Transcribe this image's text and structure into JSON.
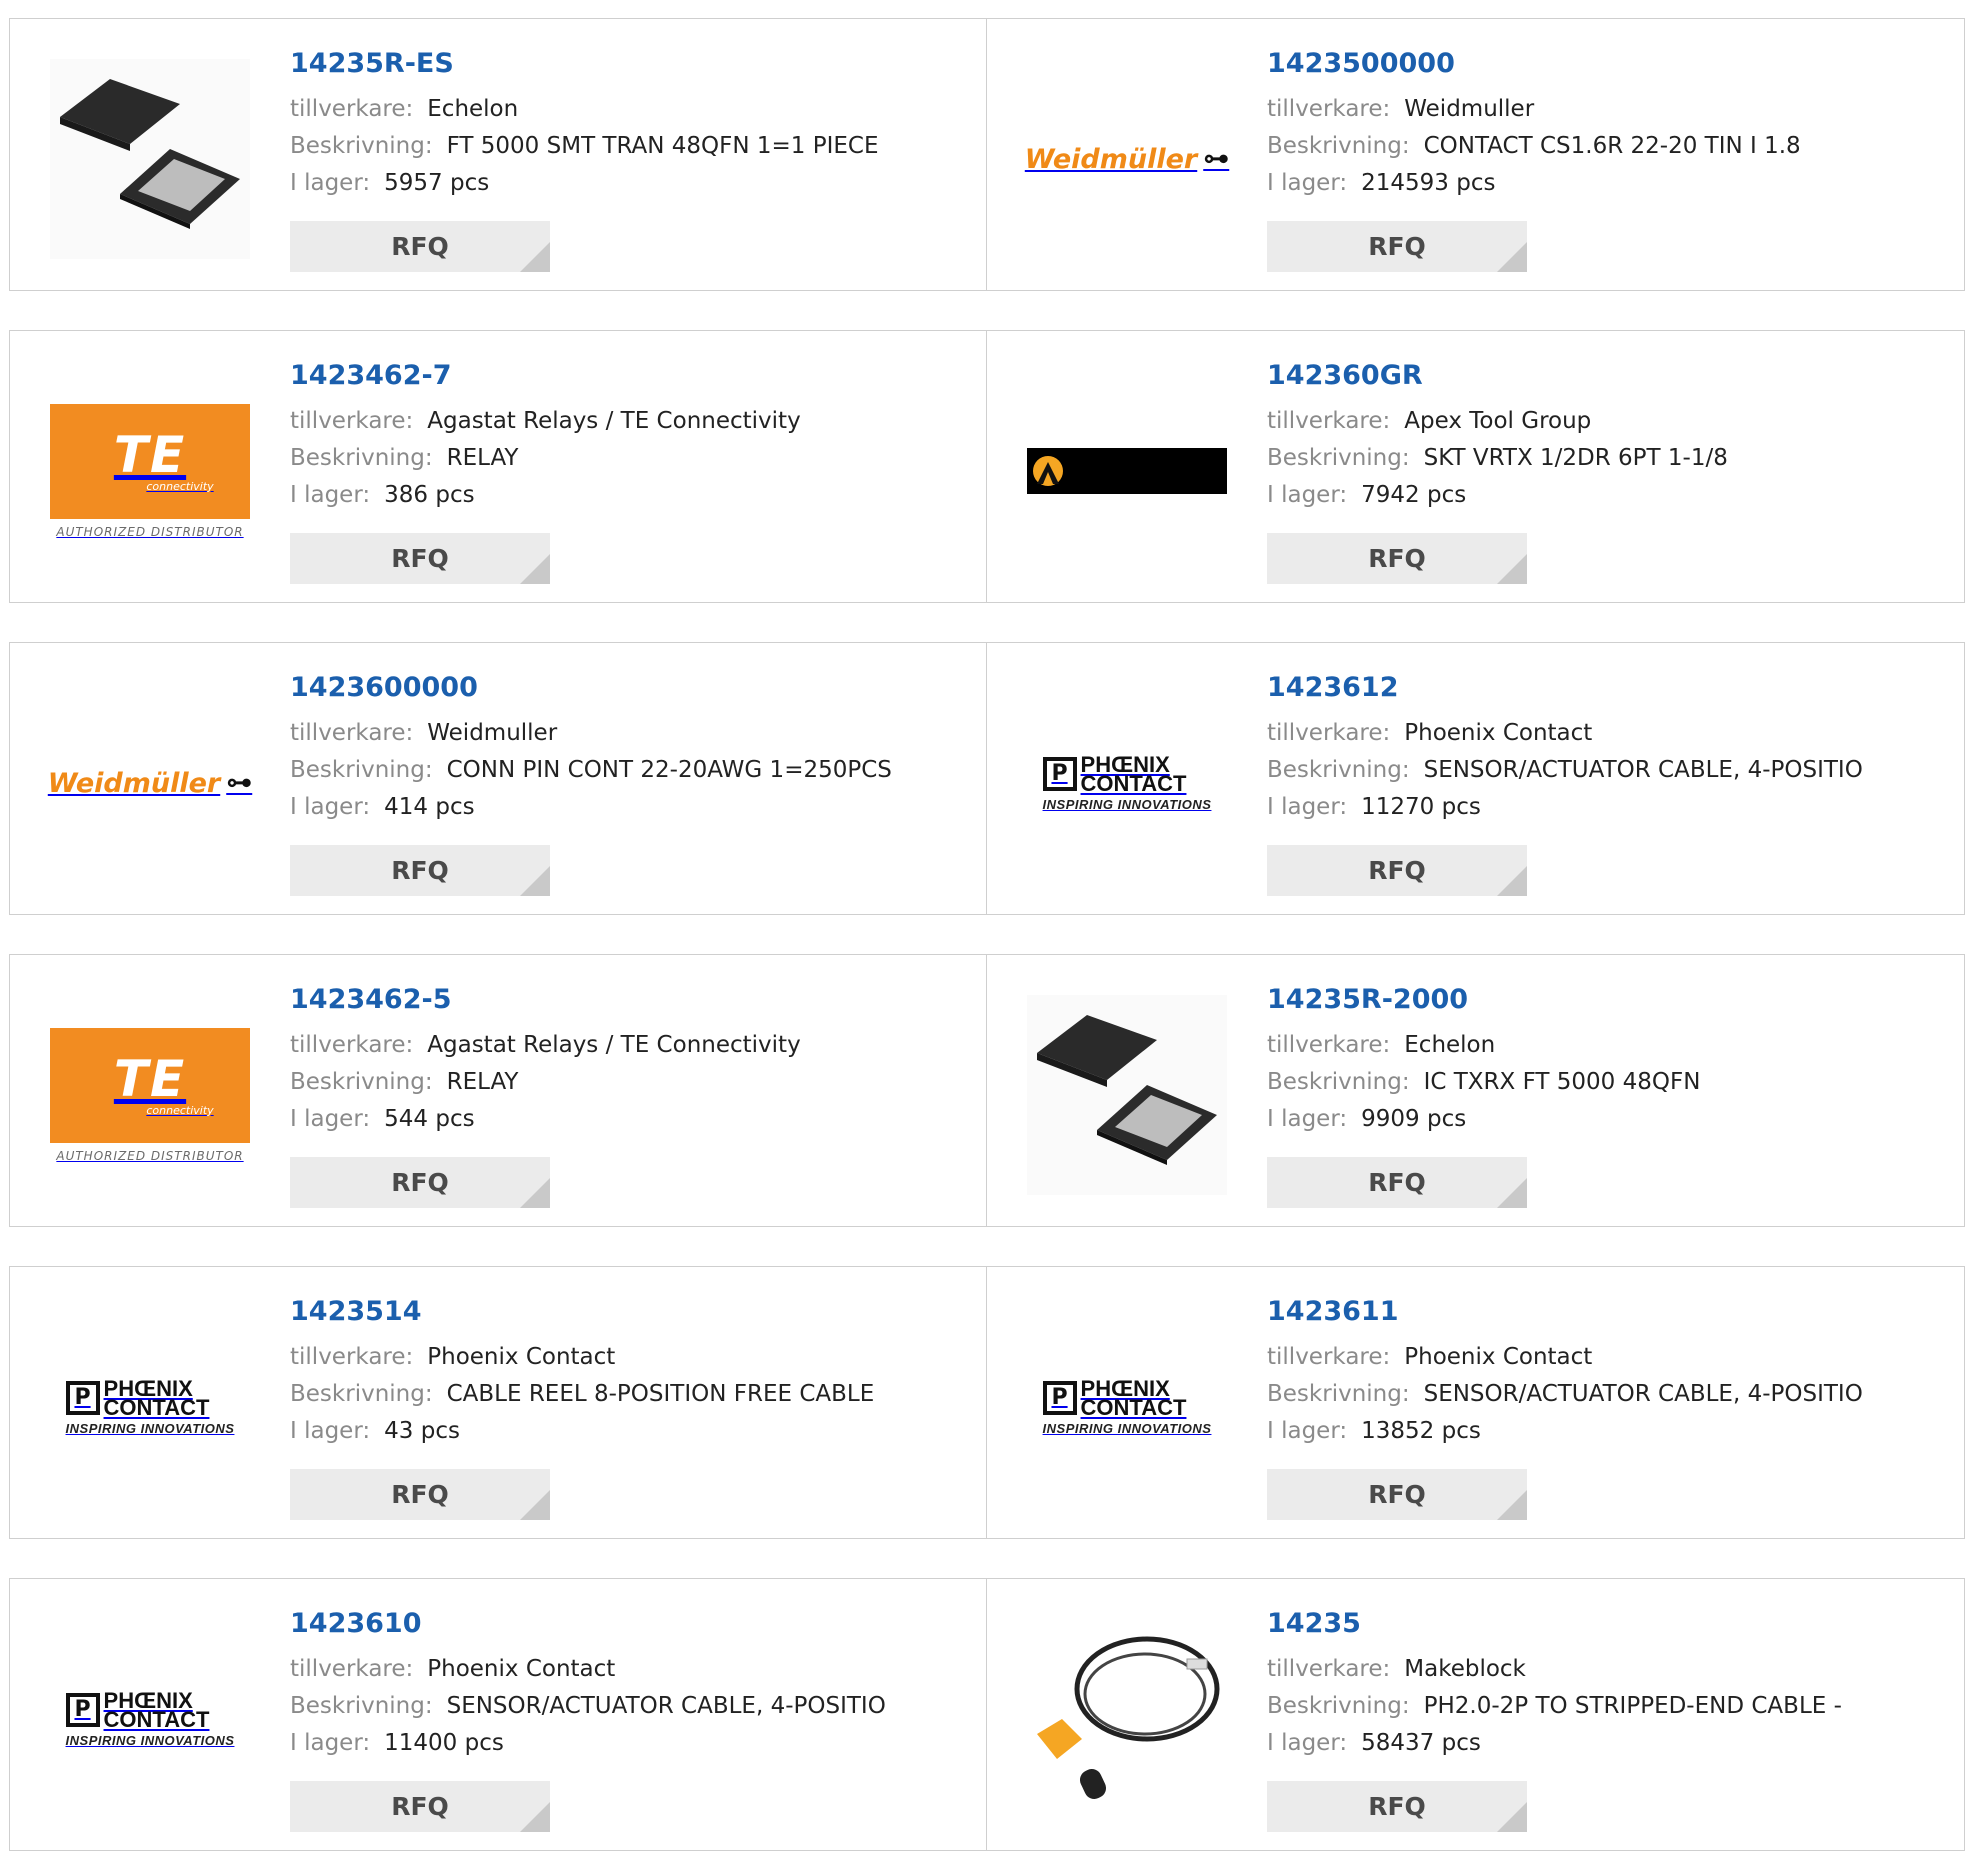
{
  "labels": {
    "manufacturer": "tillverkare:",
    "description": "Beskrivning:",
    "stock": "I lager:",
    "rfq": "RFQ"
  },
  "products": [
    {
      "part": "14235R-ES",
      "manufacturer": "Echelon",
      "description": "FT 5000 SMT TRAN 48QFN 1=1 PIECE",
      "stock": "5957 pcs",
      "image": "chip-image"
    },
    {
      "part": "1423500000",
      "manufacturer": "Weidmuller",
      "description": "CONTACT CS1.6R 22-20 TIN I 1.8",
      "stock": "214593 pcs",
      "image": "weidmuller-logo"
    },
    {
      "part": "1423462-7",
      "manufacturer": "Agastat Relays / TE Connectivity",
      "description": "RELAY",
      "stock": "386 pcs",
      "image": "te-logo"
    },
    {
      "part": "142360GR",
      "manufacturer": "Apex Tool Group",
      "description": "SKT VRTX 1/2DR 6PT 1-1/8",
      "stock": "7942 pcs",
      "image": "apex-logo"
    },
    {
      "part": "1423600000",
      "manufacturer": "Weidmuller",
      "description": "CONN PIN CONT 22-20AWG 1=250PCS",
      "stock": "414 pcs",
      "image": "weidmuller-logo"
    },
    {
      "part": "1423612",
      "manufacturer": "Phoenix Contact",
      "description": "SENSOR/ACTUATOR CABLE, 4-POSITIO",
      "stock": "11270 pcs",
      "image": "phoenix-logo"
    },
    {
      "part": "1423462-5",
      "manufacturer": "Agastat Relays / TE Connectivity",
      "description": "RELAY",
      "stock": "544 pcs",
      "image": "te-logo"
    },
    {
      "part": "14235R-2000",
      "manufacturer": "Echelon",
      "description": "IC TXRX FT 5000 48QFN",
      "stock": "9909 pcs",
      "image": "chip-image"
    },
    {
      "part": "1423514",
      "manufacturer": "Phoenix Contact",
      "description": "CABLE REEL 8-POSITION FREE CABLE",
      "stock": "43 pcs",
      "image": "phoenix-logo"
    },
    {
      "part": "1423611",
      "manufacturer": "Phoenix Contact",
      "description": "SENSOR/ACTUATOR CABLE, 4-POSITIO",
      "stock": "13852 pcs",
      "image": "phoenix-logo"
    },
    {
      "part": "1423610",
      "manufacturer": "Phoenix Contact",
      "description": "SENSOR/ACTUATOR CABLE, 4-POSITIO",
      "stock": "11400 pcs",
      "image": "phoenix-logo"
    },
    {
      "part": "14235",
      "manufacturer": "Makeblock",
      "description": "PH2.0-2P TO STRIPPED-END CABLE -",
      "stock": "58437 pcs",
      "image": "cable-image"
    }
  ],
  "logos": {
    "weidmuller": "Weidmüller",
    "te_main": "TE",
    "te_small": "connectivity",
    "te_sub": "AUTHORIZED DISTRIBUTOR",
    "phoenix_line1": "PHŒNIX",
    "phoenix_line2": "CONTACT",
    "phoenix_tag": "INSPIRING INNOVATIONS"
  },
  "colors": {
    "part_link": "#1b5fad",
    "weidmuller_orange": "#f08a17",
    "te_orange": "#f28c21",
    "rfq_bg": "#ebebeb"
  }
}
